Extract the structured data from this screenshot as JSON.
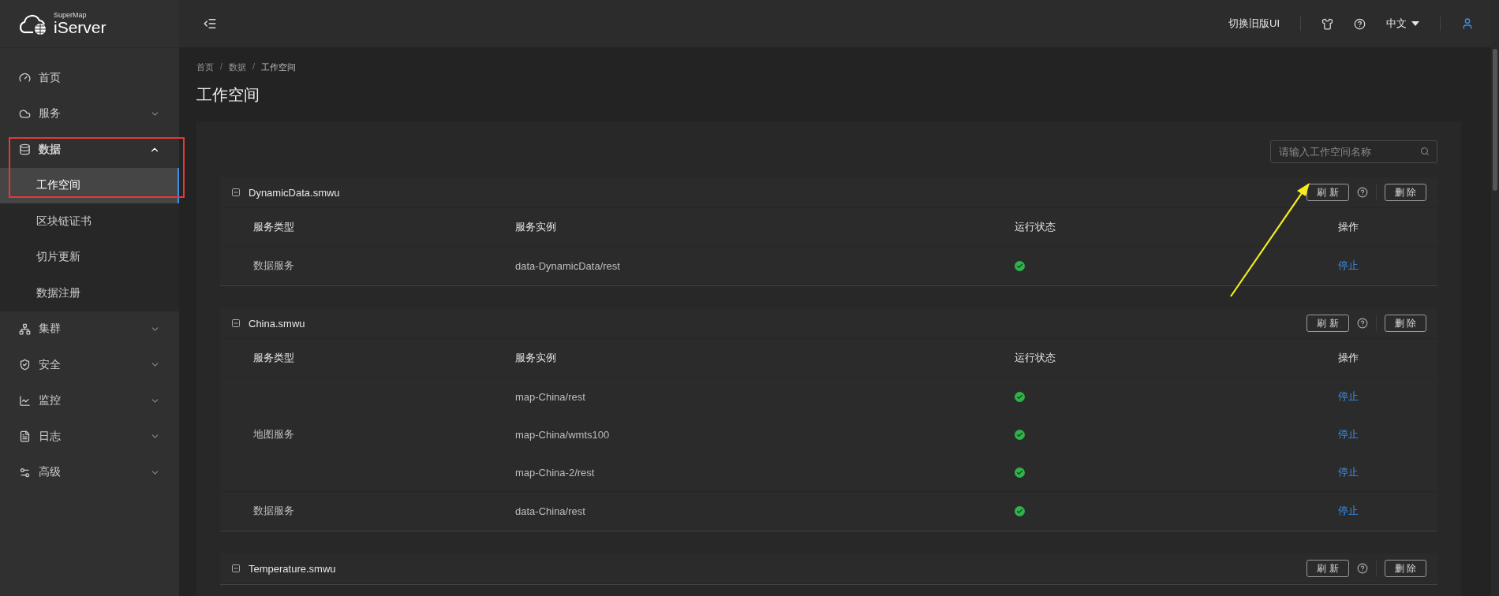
{
  "logo": {
    "small": "SuperMap",
    "large": "iServer"
  },
  "header": {
    "switch_ui": "切换旧版UI",
    "language": "中文"
  },
  "sidebar": {
    "items": [
      {
        "label": "首页",
        "selected": false
      },
      {
        "label": "服务",
        "expanded": false,
        "selected": false
      },
      {
        "label": "数据",
        "expanded": true,
        "selected": false,
        "children": [
          {
            "label": "工作空间",
            "selected": true
          },
          {
            "label": "区块链证书",
            "selected": false
          },
          {
            "label": "切片更新",
            "selected": false
          },
          {
            "label": "数据注册",
            "selected": false
          }
        ]
      },
      {
        "label": "集群",
        "expanded": false,
        "selected": false
      },
      {
        "label": "安全",
        "expanded": false,
        "selected": false
      },
      {
        "label": "监控",
        "expanded": false,
        "selected": false
      },
      {
        "label": "日志",
        "expanded": false,
        "selected": false
      },
      {
        "label": "高级",
        "expanded": false,
        "selected": false
      }
    ]
  },
  "breadcrumb": [
    {
      "kind": "link",
      "text": "首页"
    },
    {
      "kind": "separator",
      "text": "/"
    },
    {
      "kind": "link",
      "text": "数据"
    },
    {
      "kind": "separator",
      "text": "/"
    },
    {
      "kind": "current",
      "text": "工作空间"
    }
  ],
  "page_title": "工作空间",
  "search": {
    "placeholder": "请输入工作空间名称"
  },
  "workspaces": [
    {
      "name": "DynamicData.smwu",
      "expanded": true,
      "refresh": "刷 新",
      "delete": "删 除",
      "columns": [
        "服务类型",
        "服务实例",
        "运行状态",
        "操作"
      ],
      "groups": [
        {
          "type": "数据服务",
          "instances": [
            {
              "name": "data-DynamicData/rest",
              "running": true,
              "action": "停止"
            }
          ]
        }
      ]
    },
    {
      "name": "China.smwu",
      "expanded": true,
      "refresh": "刷 新",
      "delete": "删 除",
      "columns": [
        "服务类型",
        "服务实例",
        "运行状态",
        "操作"
      ],
      "groups": [
        {
          "type": "地图服务",
          "instances": [
            {
              "name": "map-China/rest",
              "running": true,
              "action": "停止"
            },
            {
              "name": "map-China/wmts100",
              "running": true,
              "action": "停止"
            },
            {
              "name": "map-China-2/rest",
              "running": true,
              "action": "停止"
            }
          ]
        },
        {
          "type": "数据服务",
          "instances": [
            {
              "name": "data-China/rest",
              "running": true,
              "action": "停止"
            }
          ]
        }
      ]
    },
    {
      "name": "Temperature.smwu",
      "expanded": true,
      "refresh": "刷 新",
      "delete": "删 除"
    }
  ]
}
